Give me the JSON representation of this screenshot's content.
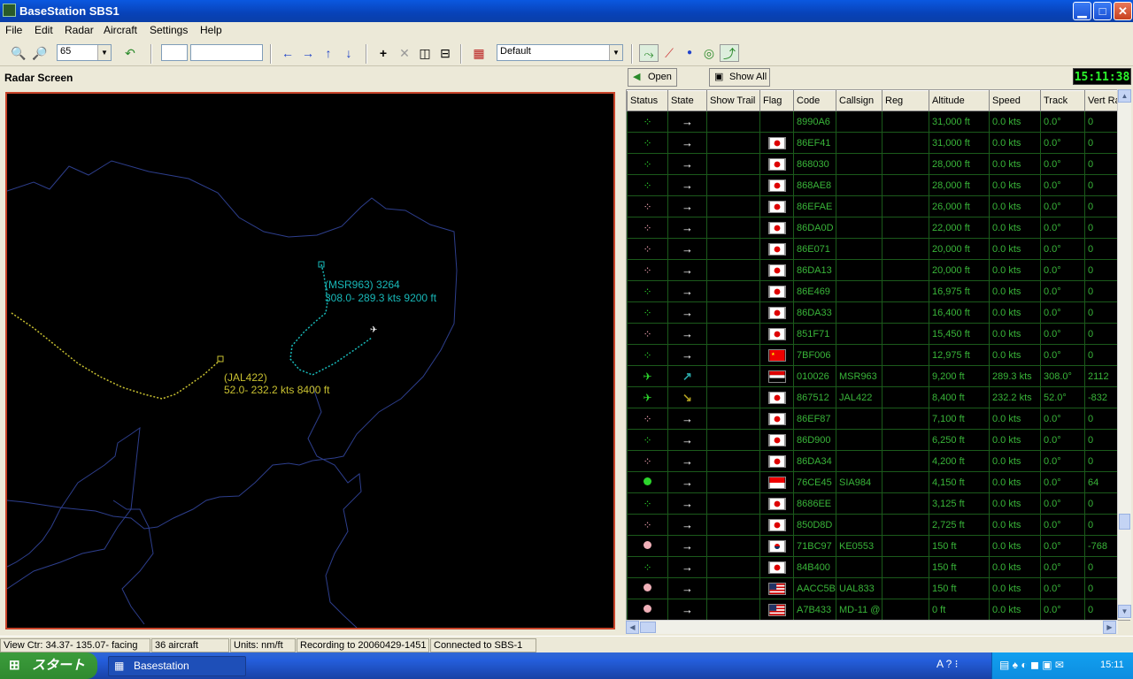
{
  "window": {
    "title": "BaseStation SBS1",
    "minimize": "▁",
    "maximize": "□",
    "close": "✕"
  },
  "menu": [
    "File",
    "Edit",
    "Radar",
    "Aircraft",
    "Settings",
    "Help"
  ],
  "toolbar": {
    "zoom_value": "65",
    "profile": "Default"
  },
  "radar_label": "Radar Screen",
  "panel": {
    "open_label": "Open",
    "show_all_label": "Show All",
    "clock": "15:11:38"
  },
  "columns": [
    "Status",
    "State",
    "Show Trail",
    "Flag",
    "Code",
    "Callsign",
    "Reg",
    "Altitude",
    "Speed",
    "Track",
    "Vert Rate"
  ],
  "rows": [
    {
      "status": "dots-green",
      "state": "→",
      "flag": "",
      "code": "8990A6",
      "callsign": "",
      "alt": "31,000 ft",
      "speed": "0.0 kts",
      "track": "0.0°",
      "vr": "0"
    },
    {
      "status": "dots-green",
      "state": "→",
      "flag": "jp",
      "code": "86EF41",
      "callsign": "",
      "alt": "31,000 ft",
      "speed": "0.0 kts",
      "track": "0.0°",
      "vr": "0"
    },
    {
      "status": "dots-green",
      "state": "→",
      "flag": "jp",
      "code": "868030",
      "callsign": "",
      "alt": "28,000 ft",
      "speed": "0.0 kts",
      "track": "0.0°",
      "vr": "0"
    },
    {
      "status": "dots-green",
      "state": "→",
      "flag": "jp",
      "code": "868AE8",
      "callsign": "",
      "alt": "28,000 ft",
      "speed": "0.0 kts",
      "track": "0.0°",
      "vr": "0"
    },
    {
      "status": "dots-pink",
      "state": "→",
      "flag": "jp",
      "code": "86EFAE",
      "callsign": "",
      "alt": "26,000 ft",
      "speed": "0.0 kts",
      "track": "0.0°",
      "vr": "0"
    },
    {
      "status": "dots-pink",
      "state": "→",
      "flag": "jp",
      "code": "86DA0D",
      "callsign": "",
      "alt": "22,000 ft",
      "speed": "0.0 kts",
      "track": "0.0°",
      "vr": "0"
    },
    {
      "status": "dots-pink",
      "state": "→",
      "flag": "jp",
      "code": "86E071",
      "callsign": "",
      "alt": "20,000 ft",
      "speed": "0.0 kts",
      "track": "0.0°",
      "vr": "0"
    },
    {
      "status": "dots-pink",
      "state": "→",
      "flag": "jp",
      "code": "86DA13",
      "callsign": "",
      "alt": "20,000 ft",
      "speed": "0.0 kts",
      "track": "0.0°",
      "vr": "0"
    },
    {
      "status": "dots-green",
      "state": "→",
      "flag": "jp",
      "code": "86E469",
      "callsign": "",
      "alt": "16,975 ft",
      "speed": "0.0 kts",
      "track": "0.0°",
      "vr": "0"
    },
    {
      "status": "dots-green",
      "state": "→",
      "flag": "jp",
      "code": "86DA33",
      "callsign": "",
      "alt": "16,400 ft",
      "speed": "0.0 kts",
      "track": "0.0°",
      "vr": "0"
    },
    {
      "status": "dots-pink",
      "state": "→",
      "flag": "jp",
      "code": "851F71",
      "callsign": "",
      "alt": "15,450 ft",
      "speed": "0.0 kts",
      "track": "0.0°",
      "vr": "0"
    },
    {
      "status": "dots-green",
      "state": "→",
      "flag": "cn",
      "code": "7BF006",
      "callsign": "",
      "alt": "12,975 ft",
      "speed": "0.0 kts",
      "track": "0.0°",
      "vr": "0"
    },
    {
      "status": "plane",
      "state": "↗",
      "flag": "eg",
      "code": "010026",
      "callsign": "MSR963",
      "alt": "9,200 ft",
      "speed": "289.3 kts",
      "track": "308.0°",
      "vr": "2112"
    },
    {
      "status": "plane",
      "state": "↘",
      "flag": "jp",
      "code": "867512",
      "callsign": "JAL422",
      "alt": "8,400 ft",
      "speed": "232.2 kts",
      "track": "52.0°",
      "vr": "-832"
    },
    {
      "status": "dots-pink",
      "state": "→",
      "flag": "jp",
      "code": "86EF87",
      "callsign": "",
      "alt": "7,100 ft",
      "speed": "0.0 kts",
      "track": "0.0°",
      "vr": "0"
    },
    {
      "status": "dots-green",
      "state": "→",
      "flag": "jp",
      "code": "86D900",
      "callsign": "",
      "alt": "6,250 ft",
      "speed": "0.0 kts",
      "track": "0.0°",
      "vr": "0"
    },
    {
      "status": "dots-pink",
      "state": "→",
      "flag": "jp",
      "code": "86DA34",
      "callsign": "",
      "alt": "4,200 ft",
      "speed": "0.0 kts",
      "track": "0.0°",
      "vr": "0"
    },
    {
      "status": "dot-green",
      "state": "→",
      "flag": "sg",
      "code": "76CE45",
      "callsign": "SIA984",
      "alt": "4,150 ft",
      "speed": "0.0 kts",
      "track": "0.0°",
      "vr": "64"
    },
    {
      "status": "dots-green",
      "state": "→",
      "flag": "jp",
      "code": "8686EE",
      "callsign": "",
      "alt": "3,125 ft",
      "speed": "0.0 kts",
      "track": "0.0°",
      "vr": "0"
    },
    {
      "status": "dots-pink",
      "state": "→",
      "flag": "jp",
      "code": "850D8D",
      "callsign": "",
      "alt": "2,725 ft",
      "speed": "0.0 kts",
      "track": "0.0°",
      "vr": "0"
    },
    {
      "status": "dot-pink",
      "state": "→",
      "flag": "kr",
      "code": "71BC97",
      "callsign": "KE0553",
      "alt": "150 ft",
      "speed": "0.0 kts",
      "track": "0.0°",
      "vr": "-768"
    },
    {
      "status": "dots-green",
      "state": "→",
      "flag": "jp",
      "code": "84B400",
      "callsign": "",
      "alt": "150 ft",
      "speed": "0.0 kts",
      "track": "0.0°",
      "vr": "0"
    },
    {
      "status": "dot-pink",
      "state": "→",
      "flag": "us",
      "code": "AACC5B",
      "callsign": "UAL833",
      "alt": "150 ft",
      "speed": "0.0 kts",
      "track": "0.0°",
      "vr": "0"
    },
    {
      "status": "dot-pink",
      "state": "→",
      "flag": "us",
      "code": "A7B433",
      "callsign": " MD-11 @",
      "alt": "0 ft",
      "speed": "0.0 kts",
      "track": "0.0°",
      "vr": "0"
    }
  ],
  "radar": {
    "msr_line1": "(MSR963) 3264",
    "msr_line2": "308.0- 289.3 kts 9200 ft",
    "jal_line1": "(JAL422)",
    "jal_line2": "52.0- 232.2 kts 8400 ft"
  },
  "status": {
    "view": "View Ctr: 34.37- 135.07- facing",
    "count": "36 aircraft",
    "units": "Units: nm/ft",
    "recording": "Recording to 20060429-1451",
    "connected": "Connected to SBS-1"
  },
  "taskbar": {
    "start": "スタート",
    "task": "Basestation",
    "time": "15:11"
  }
}
